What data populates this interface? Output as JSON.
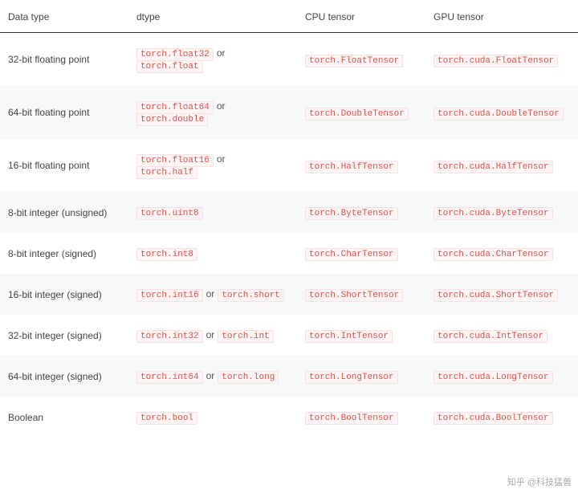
{
  "headers": {
    "data_type": "Data type",
    "dtype": "dtype",
    "cpu": "CPU tensor",
    "gpu": "GPU tensor"
  },
  "or_label": "or",
  "rows": [
    {
      "data_type": "32-bit floating point",
      "dtype1": "torch.float32",
      "dtype2": "torch.float",
      "cpu": "torch.FloatTensor",
      "gpu": "torch.cuda.FloatTensor"
    },
    {
      "data_type": "64-bit floating point",
      "dtype1": "torch.float64",
      "dtype2": "torch.double",
      "cpu": "torch.DoubleTensor",
      "gpu": "torch.cuda.DoubleTensor"
    },
    {
      "data_type": "16-bit floating point",
      "dtype1": "torch.float16",
      "dtype2": "torch.half",
      "cpu": "torch.HalfTensor",
      "gpu": "torch.cuda.HalfTensor"
    },
    {
      "data_type": "8-bit integer (unsigned)",
      "dtype1": "torch.uint8",
      "dtype2": "",
      "cpu": "torch.ByteTensor",
      "gpu": "torch.cuda.ByteTensor"
    },
    {
      "data_type": "8-bit integer (signed)",
      "dtype1": "torch.int8",
      "dtype2": "",
      "cpu": "torch.CharTensor",
      "gpu": "torch.cuda.CharTensor"
    },
    {
      "data_type": "16-bit integer (signed)",
      "dtype1": "torch.int16",
      "dtype2": "torch.short",
      "cpu": "torch.ShortTensor",
      "gpu": "torch.cuda.ShortTensor"
    },
    {
      "data_type": "32-bit integer (signed)",
      "dtype1": "torch.int32",
      "dtype2": "torch.int",
      "cpu": "torch.IntTensor",
      "gpu": "torch.cuda.IntTensor"
    },
    {
      "data_type": "64-bit integer (signed)",
      "dtype1": "torch.int64",
      "dtype2": "torch.long",
      "cpu": "torch.LongTensor",
      "gpu": "torch.cuda.LongTensor"
    },
    {
      "data_type": "Boolean",
      "dtype1": "torch.bool",
      "dtype2": "",
      "cpu": "torch.BoolTensor",
      "gpu": "torch.cuda.BoolTensor"
    }
  ],
  "watermark": "知乎 @科技猛兽"
}
